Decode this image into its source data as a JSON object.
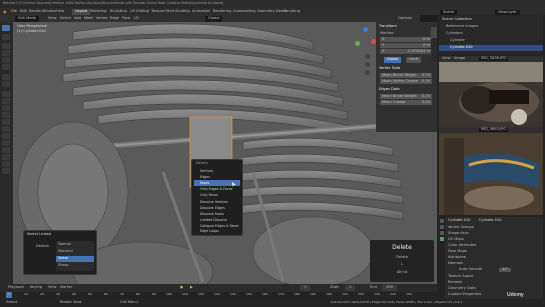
{
  "window_title": "Blender* [C:\\Online Courses\\Creative 1000 Harley-Davidson\\Knucklehead with Blender Scene Real Creative Mettle\\cyclinder04.blend]",
  "top_menu": [
    "File",
    "Edit",
    "Render",
    "Window",
    "Help",
    "Layout",
    "Modeling",
    "Sculpting",
    "UV Editing",
    "Texture Paint",
    "Shading",
    "Animation",
    "Rendering",
    "Compositing",
    "Geometry Nodes",
    "Scripting"
  ],
  "scene_label": "Scene",
  "view_layer_label": "ViewLayer",
  "header": {
    "mode": "Edit Mode",
    "menus": [
      "View",
      "Select",
      "Add",
      "Mesh",
      "Vertex",
      "Edge",
      "Face",
      "UV"
    ],
    "transform": "Global",
    "pivot": "Options"
  },
  "viewport": {
    "view_name": "User Perspective",
    "object_name": "(1) Cylinder.010"
  },
  "n_panel": {
    "tabs": [
      "Item",
      "Tool",
      "View"
    ],
    "title": "Transform",
    "median_label": "Median:",
    "fields": [
      {
        "label": "X",
        "value": "0 m"
      },
      {
        "label": "Y",
        "value": "0 m"
      },
      {
        "label": "Z",
        "value": "-0.078464 m"
      }
    ],
    "global_local": [
      "Global",
      "Local"
    ],
    "crease_title": "Vertex Data",
    "crease": [
      {
        "label": "Mean Bevel Weight",
        "value": "0.00"
      },
      {
        "label": "Mean Vertex Crease",
        "value": "0.00"
      }
    ],
    "edge_title": "Edges Data",
    "edge": [
      {
        "label": "Mean Bevel Weight",
        "value": "0.00"
      },
      {
        "label": "Mean Crease",
        "value": "0.00"
      }
    ]
  },
  "delete_menu": {
    "title": "Delete",
    "items": [
      "Vertices",
      "Edges",
      "Faces",
      "Only Edges & Faces",
      "Only Faces",
      "Dissolve Vertices",
      "Dissolve Edges",
      "Dissolve Faces",
      "Limited Dissolve",
      "Collapse Edges & Faces",
      "Edge Loops"
    ],
    "highlighted": "Faces"
  },
  "last_op_panel": {
    "title": "Select Linked",
    "label": "Delimit",
    "options": [
      "Normal",
      "Material",
      "Seam",
      "Sharp"
    ],
    "selected": "Seam"
  },
  "delete_popup": {
    "title": "Delete",
    "type_label": "Delete",
    "key": "L",
    "shortcut": "Alt+A"
  },
  "outliner": {
    "items": [
      "Scene Collection",
      "Reference Images",
      "Cylinders",
      "Cylinder",
      "Cylinder.010"
    ]
  },
  "image_editor": {
    "top_header": [
      "View",
      "Image"
    ],
    "top_filename": "IMG_5836.JPG",
    "bottom_filename": "IMG_5863.JPG"
  },
  "properties": {
    "object": "Cylinder.010",
    "data": "Cylinder.010",
    "sections": [
      "Vertex Groups",
      "Shape Keys",
      "UV Maps",
      "Color Attributes",
      "Face Maps",
      "Attributes",
      "Normals",
      "Texture Space",
      "Remesh",
      "Geometry Data",
      "Custom Properties"
    ],
    "auto_smooth_label": "Auto Smooth",
    "auto_smooth_value": "30°"
  },
  "timeline": {
    "menus": [
      "Playback",
      "Keying",
      "View",
      "Marker"
    ],
    "frame": "1",
    "start_label": "Start",
    "start": "1",
    "end_label": "End",
    "end": "250",
    "ticks": [
      "0",
      "10",
      "20",
      "30",
      "40",
      "50",
      "60",
      "70",
      "80",
      "90",
      "100",
      "110",
      "120",
      "130",
      "140",
      "150",
      "160",
      "170",
      "180",
      "190",
      "200",
      "210",
      "220",
      "230",
      "240",
      "250"
    ]
  },
  "status_bar": {
    "left": "Select",
    "mid": "Rotate View",
    "right": "Call Menu",
    "stats": "Cylinder.010 | Verts 0/576 | Edges 0/1,104 | Faces 0/530 | Tris 1,112 | Objects 1/3 | 3.4.1"
  },
  "watermark": "Udemy",
  "colors": {
    "accent": "#4772b3",
    "highlight": "#5680c2",
    "orange": "#e69a3a"
  }
}
